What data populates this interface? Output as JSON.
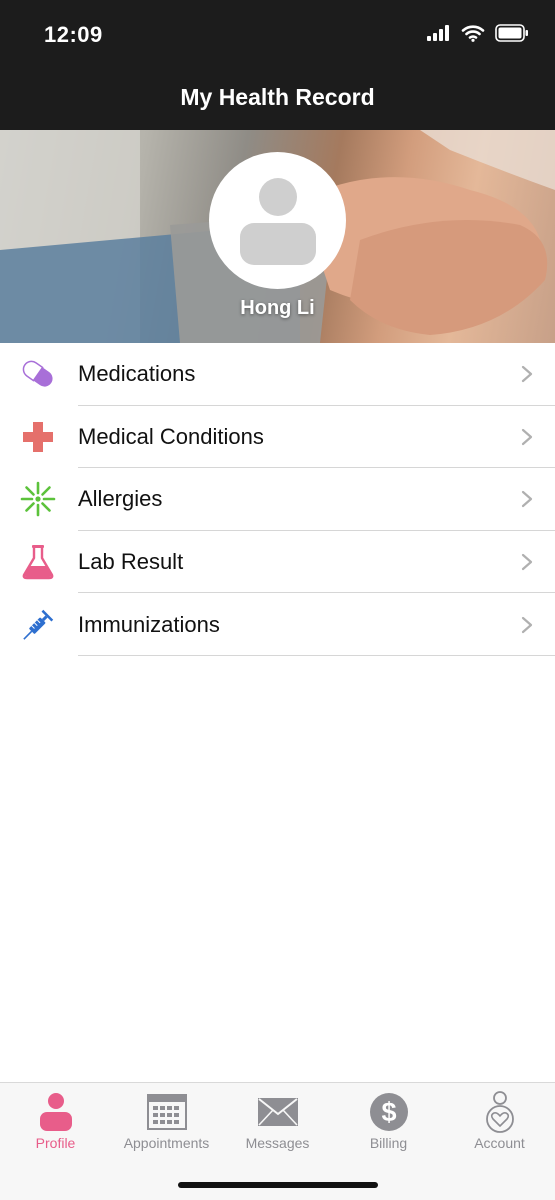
{
  "status_bar": {
    "time": "12:09",
    "icons": [
      "cellular-signal-icon",
      "wifi-icon",
      "battery-icon"
    ]
  },
  "header": {
    "title": "My Health Record"
  },
  "profile": {
    "name": "Hong Li",
    "avatar_icon": "person-placeholder-icon"
  },
  "menu": {
    "items": [
      {
        "label": "Medications",
        "icon": "pill-icon",
        "color": "#a86fd8"
      },
      {
        "label": "Medical Conditions",
        "icon": "medical-cross-icon",
        "color": "#e5706b"
      },
      {
        "label": "Allergies",
        "icon": "allergen-burst-icon",
        "color": "#5cc23b"
      },
      {
        "label": "Lab Result",
        "icon": "flask-icon",
        "color": "#e85d8a"
      },
      {
        "label": "Immunizations",
        "icon": "syringe-icon",
        "color": "#2e6fcf"
      }
    ]
  },
  "tab_bar": {
    "active": "Profile",
    "active_color": "#e85d8a",
    "inactive_color": "#8e8e93",
    "tabs": [
      {
        "label": "Profile",
        "icon": "person-icon"
      },
      {
        "label": "Appointments",
        "icon": "calendar-icon"
      },
      {
        "label": "Messages",
        "icon": "envelope-icon"
      },
      {
        "label": "Billing",
        "icon": "dollar-icon"
      },
      {
        "label": "Account",
        "icon": "account-heart-icon"
      }
    ]
  }
}
